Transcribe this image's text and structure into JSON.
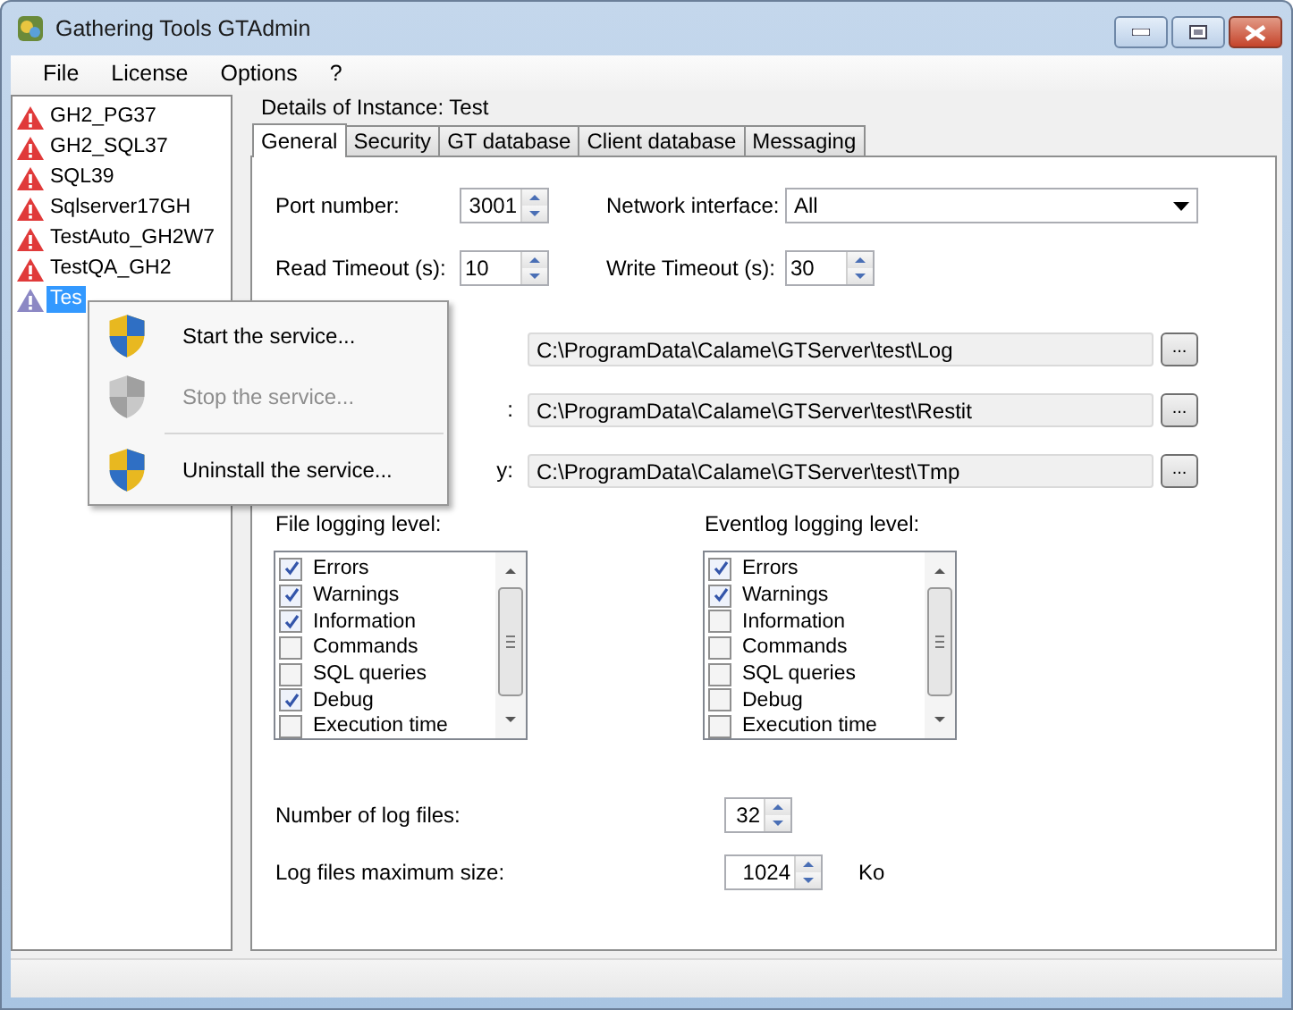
{
  "window": {
    "title": "Gathering Tools GTAdmin"
  },
  "menu": [
    "File",
    "License",
    "Options",
    "?"
  ],
  "tree": [
    {
      "label": "GH2_PG37",
      "color": "#e03a3a",
      "selected": false
    },
    {
      "label": "GH2_SQL37",
      "color": "#e03a3a",
      "selected": false
    },
    {
      "label": "SQL39",
      "color": "#e03a3a",
      "selected": false
    },
    {
      "label": "Sqlserver17GH",
      "color": "#e03a3a",
      "selected": false
    },
    {
      "label": "TestAuto_GH2W7",
      "color": "#e03a3a",
      "selected": false
    },
    {
      "label": "TestQA_GH2",
      "color": "#e03a3a",
      "selected": false
    },
    {
      "label": "Tes",
      "color": "#8c88c4",
      "selected": true
    }
  ],
  "details_title": "Details of Instance: Test",
  "tabs": [
    {
      "label": "General",
      "selected": true
    },
    {
      "label": "Security",
      "selected": false
    },
    {
      "label": "GT database",
      "selected": false
    },
    {
      "label": "Client database",
      "selected": false
    },
    {
      "label": "Messaging",
      "selected": false
    }
  ],
  "port": {
    "label": "Port number:",
    "value": "3001"
  },
  "network": {
    "label": "Network interface:",
    "value": "All"
  },
  "read_timeout": {
    "label": "Read Timeout (s):",
    "value": "10"
  },
  "write_timeout": {
    "label": "Write Timeout (s):",
    "value": "30"
  },
  "paths": [
    {
      "value": "C:\\ProgramData\\Calame\\GTServer\\test\\Log",
      "button": "..."
    },
    {
      "label": ":",
      "value": "C:\\ProgramData\\Calame\\GTServer\\test\\Restit",
      "button": "..."
    },
    {
      "label": "y:",
      "value": "C:\\ProgramData\\Calame\\GTServer\\test\\Tmp",
      "button": "..."
    }
  ],
  "logging": [
    {
      "label": "File logging level:",
      "items": [
        {
          "label": "Errors",
          "checked": true
        },
        {
          "label": "Warnings",
          "checked": true
        },
        {
          "label": "Information",
          "checked": true
        },
        {
          "label": "Commands",
          "checked": false
        },
        {
          "label": "SQL queries",
          "checked": false
        },
        {
          "label": "Debug",
          "checked": true
        },
        {
          "label": "Execution time",
          "checked": false
        }
      ]
    },
    {
      "label": "Eventlog logging level:",
      "items": [
        {
          "label": "Errors",
          "checked": true
        },
        {
          "label": "Warnings",
          "checked": true
        },
        {
          "label": "Information",
          "checked": false
        },
        {
          "label": "Commands",
          "checked": false
        },
        {
          "label": "SQL queries",
          "checked": false
        },
        {
          "label": "Debug",
          "checked": false
        },
        {
          "label": "Execution time",
          "checked": false
        }
      ]
    }
  ],
  "log_count": {
    "label": "Number of log files:",
    "value": "32"
  },
  "log_size": {
    "label": "Log files maximum size:",
    "value": "1024",
    "unit": "Ko"
  },
  "context_menu": [
    {
      "kind": "item",
      "label": "Start the service...",
      "disabled": false
    },
    {
      "kind": "item",
      "label": "Stop the service...",
      "disabled": true
    },
    {
      "kind": "separator"
    },
    {
      "kind": "item",
      "label": "Uninstall the service...",
      "disabled": false
    }
  ]
}
